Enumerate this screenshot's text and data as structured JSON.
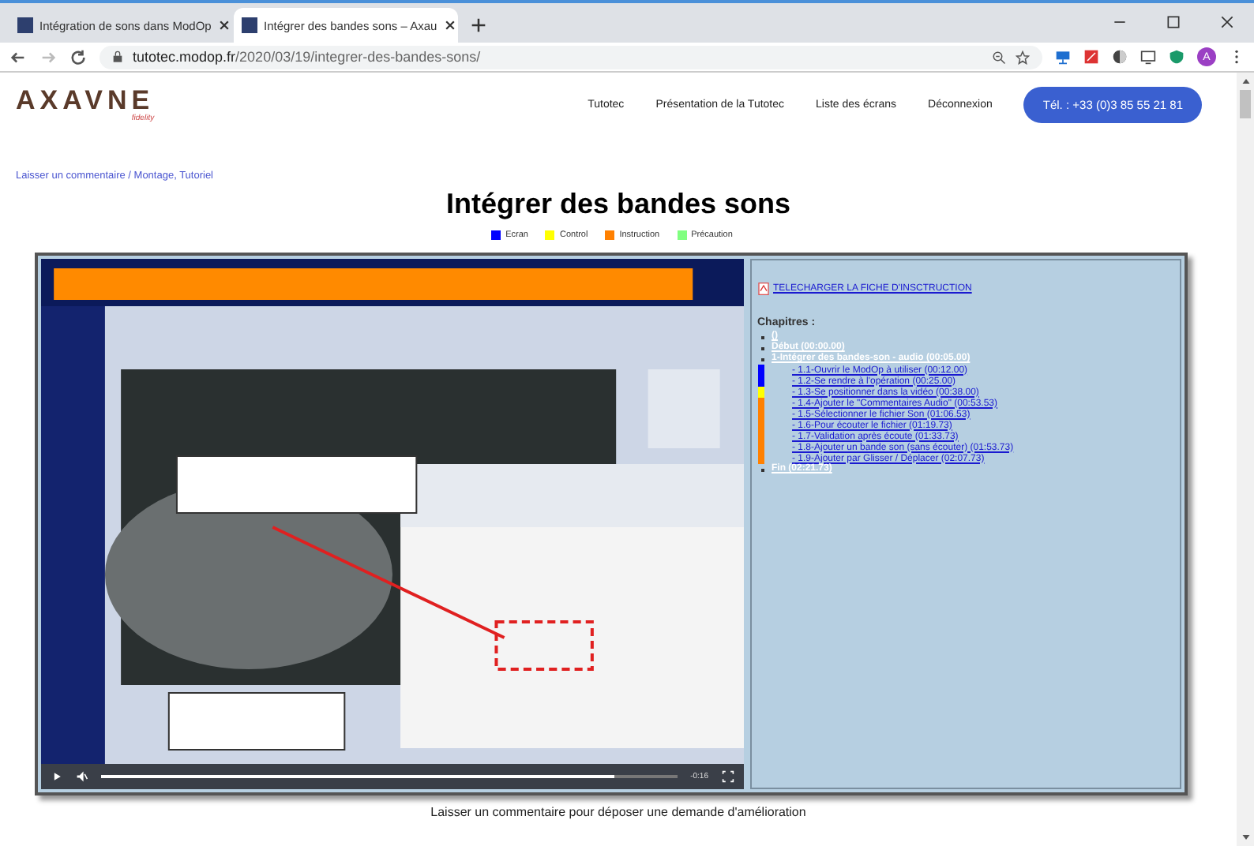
{
  "browser": {
    "tabs": [
      {
        "label": "Intégration de sons dans ModOp",
        "selected": false
      },
      {
        "label": "Intégrer des bandes sons – Axau",
        "selected": true
      }
    ],
    "url_host": "tutotec.modop.fr",
    "url_path": "/2020/03/19/integrer-des-bandes-sons/",
    "profile": "A"
  },
  "header": {
    "logo": "AXAVNE",
    "logo_sub": "fidelity",
    "nav": [
      "Tutotec",
      "Présentation de la Tutotec",
      "Liste des écrans",
      "Déconnexion"
    ],
    "phone_button": "Tél. : +33 (0)3 85 55 21 81"
  },
  "breadcrumb": "Laisser un commentaire / Montage, Tutoriel",
  "title": "Intégrer des bandes sons",
  "legend": [
    {
      "label": "Ecran",
      "color": "#0000ff"
    },
    {
      "label": "Control",
      "color": "#ffff00"
    },
    {
      "label": "Instruction",
      "color": "#ff8000"
    },
    {
      "label": "Précaution",
      "color": "#80ff80"
    }
  ],
  "video": {
    "kind": "picture",
    "time": "-0:16",
    "level": 0.89
  },
  "sidebar": {
    "download_link": "TELECHARGER LA FICHE D'INSCTRUCTION",
    "chapters_heading": "Chapitres :",
    "chapters": [
      {
        "label": "()"
      },
      {
        "label": "Début (00:00.00)"
      },
      {
        "label": "1-Intégrer des bandes-son - audio (00:05.00)",
        "children": [
          {
            "label": "- 1.1-Ouvrir le ModOp à utiliser (00:12.00)",
            "color": "#0000ff"
          },
          {
            "label": "- 1.2-Se rendre à l'opération (00:25.00)",
            "color": "#0000ff"
          },
          {
            "label": "- 1.3-Se positionner dans la vidéo (00:38.00)",
            "color": "#ffff00"
          },
          {
            "label": "- 1.4-Ajouter le \"Commentaires Audio\" (00:53.53)",
            "color": "#ff8000"
          },
          {
            "label": "- 1.5-Sélectionner le fichier Son (01:06.53)",
            "color": "#ff8000"
          },
          {
            "label": "- 1.6-Pour écouter le fichier (01:19.73)",
            "color": "#ff8000"
          },
          {
            "label": "- 1.7-Validation après écoute (01:33.73)",
            "color": "#ff8000"
          },
          {
            "label": "- 1.8-Ajouter un bande son (sans écouter) (01:53.73)",
            "color": "#ff8000"
          },
          {
            "label": "- 1.9-Ajouter par Glisser / Déplacer (02:07.73)",
            "color": "#ff8000"
          }
        ]
      },
      {
        "label": "Fin (02:21.73)"
      }
    ]
  },
  "footer_text": "Laisser un commentaire pour déposer une demande d'amélioration"
}
